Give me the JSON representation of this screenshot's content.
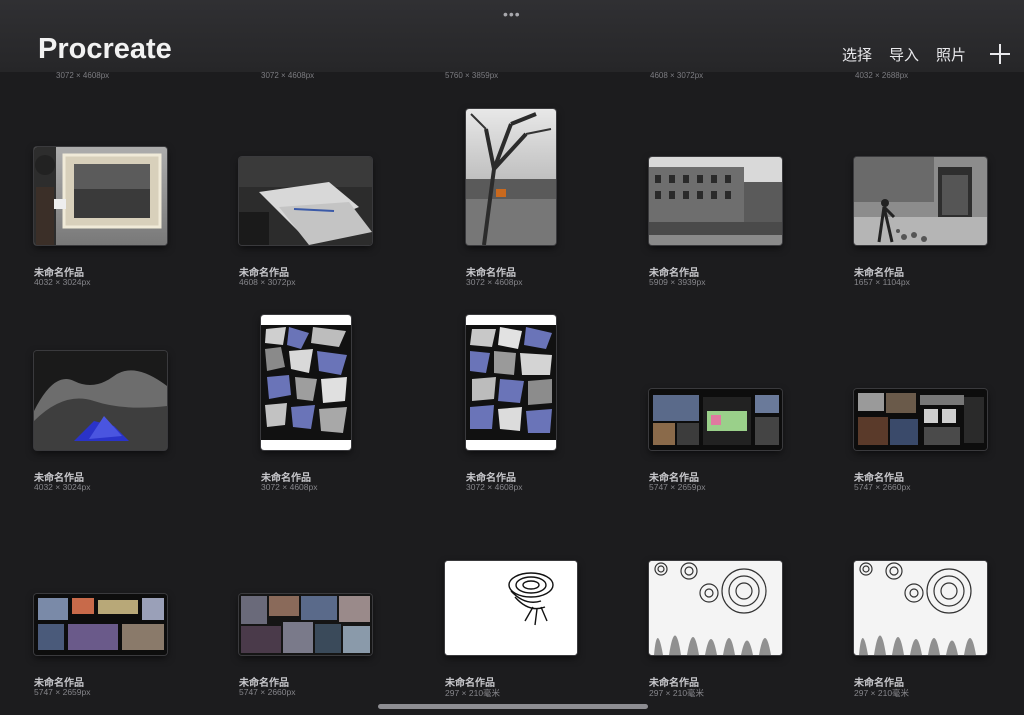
{
  "header": {
    "app_title": "Procreate",
    "menu": {
      "select": "选择",
      "import": "导入",
      "photos": "照片"
    }
  },
  "cut_row": [
    {
      "dims": "3072 × 4608px"
    },
    {
      "dims": "3072 × 4608px"
    },
    {
      "dims": "5760 × 3859px"
    },
    {
      "dims": "4608 × 3072px"
    },
    {
      "dims": "4032 × 2688px"
    }
  ],
  "artworks": [
    {
      "title": "未命名作品",
      "dims": "4032 × 3024px",
      "thumb": "museum-photo"
    },
    {
      "title": "未命名作品",
      "dims": "4608 × 3072px",
      "thumb": "desk-papers-photo"
    },
    {
      "title": "未命名作品",
      "dims": "3072 × 4608px",
      "thumb": "tree-photo"
    },
    {
      "title": "未命名作品",
      "dims": "5909 × 3939px",
      "thumb": "building-photo"
    },
    {
      "title": "未命名作品",
      "dims": "1657 × 1104px",
      "thumb": "street-phone-booth-photo"
    },
    {
      "title": "未命名作品",
      "dims": "4032 × 3024px",
      "thumb": "grass-blue-object"
    },
    {
      "title": "未命名作品",
      "dims": "3072 × 4608px",
      "thumb": "shards-collage"
    },
    {
      "title": "未命名作品",
      "dims": "3072 × 4608px",
      "thumb": "shards-collage"
    },
    {
      "title": "未命名作品",
      "dims": "5747 × 2659px",
      "thumb": "moodboard"
    },
    {
      "title": "未命名作品",
      "dims": "5747 × 2660px",
      "thumb": "moodboard"
    },
    {
      "title": "未命名作品",
      "dims": "5747 × 2659px",
      "thumb": "moodboard"
    },
    {
      "title": "未命名作品",
      "dims": "5747 × 2660px",
      "thumb": "photo-collage"
    },
    {
      "title": "未命名作品",
      "dims": "297 × 210毫米",
      "thumb": "swirl-sketch"
    },
    {
      "title": "未命名作品",
      "dims": "297 × 210毫米",
      "thumb": "swirl-pattern-sketch"
    },
    {
      "title": "未命名作品",
      "dims": "297 × 210毫米",
      "thumb": "swirl-pattern-sketch"
    }
  ],
  "colors": {
    "background": "#1c1c1e",
    "header": "#2b2b2e",
    "shard_blue": "#6a74b8"
  }
}
